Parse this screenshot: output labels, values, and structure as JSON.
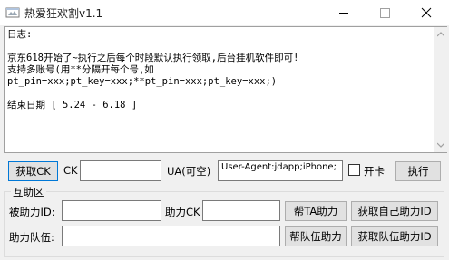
{
  "window": {
    "title": "热爱狂欢割v1.1",
    "icons": {
      "app": "app-icon",
      "minimize": "minimize-icon",
      "maximize": "maximize-icon",
      "close": "close-icon"
    }
  },
  "log": {
    "lines": [
      "日志:",
      "",
      "京东618开始了~执行之后每个时段默认执行领取,后台挂机软件即可!",
      "支持多账号(用**分隔开每个号,如",
      "pt_pin=xxx;pt_key=xxx;**pt_pin=xxx;pt_key=xxx;)",
      "",
      "结束日期 [ 5.24 - 6.18 ]"
    ]
  },
  "toolbar": {
    "get_ck_button": "获取CK",
    "ck_label": "CK",
    "ck_value": "",
    "ua_label": "UA(可空)",
    "ua_value": "User-Agent:jdapp;iPhone;",
    "open_card_label": "开卡",
    "execute_button": "执行"
  },
  "assist": {
    "group_title": "互助区",
    "helped_id_label": "被助力ID:",
    "helped_id_value": "",
    "help_ck_label": "助力CK",
    "help_ck_value": "",
    "help_ta_button": "帮TA助力",
    "get_own_id_button": "获取自己助力ID",
    "team_label": "助力队伍:",
    "team_value": "",
    "help_team_button": "帮队伍助力",
    "get_team_id_button": "获取队伍助力ID"
  }
}
